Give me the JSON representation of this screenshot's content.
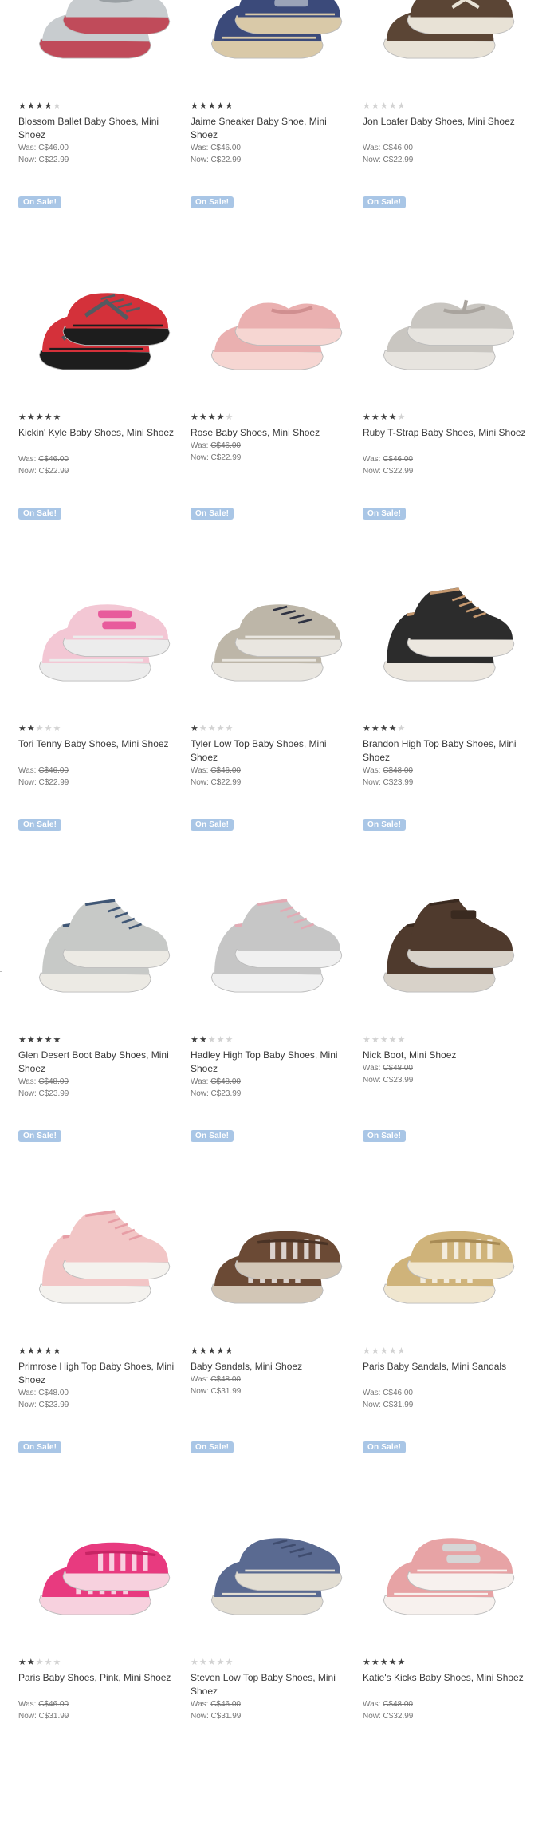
{
  "badge_label": "On Sale!",
  "was_label": "Was:",
  "now_label": "Now:",
  "products": [
    {
      "name": "Blossom Ballet Baby Shoes, Mini Shoez",
      "stars": 4,
      "was": "C$46.00",
      "now": "C$22.99",
      "image": "ballet-flat",
      "colors": [
        "#c8cccf",
        "#9aa0a4",
        "#c04b5a"
      ]
    },
    {
      "name": "Jaime Sneaker Baby Shoe, Mini Shoez",
      "stars": 5,
      "was": "C$46.00",
      "now": "C$22.99",
      "image": "velcro-sneaker",
      "colors": [
        "#3b4a7a",
        "#9aa3b8",
        "#d9c9a8"
      ]
    },
    {
      "name": "Jon Loafer Baby Shoes, Mini Shoez",
      "stars": 0,
      "was": "C$46.00",
      "now": "C$22.99",
      "image": "loafer",
      "colors": [
        "#5b4535",
        "#3f2e22",
        "#e8e2d6"
      ]
    },
    {
      "name": "Kickin' Kyle Baby Shoes, Mini Shoez",
      "stars": 5,
      "was": "C$46.00",
      "now": "C$22.99",
      "image": "sneaker",
      "colors": [
        "#d4313a",
        "#555a60",
        "#1d1d1d"
      ]
    },
    {
      "name": "Rose Baby Shoes, Mini Shoez",
      "stars": 4,
      "was": "C$46.00",
      "now": "C$22.99",
      "image": "ballet-flat",
      "colors": [
        "#eab0b0",
        "#d08f90",
        "#f6d6d2"
      ]
    },
    {
      "name": "Ruby T-Strap Baby Shoes, Mini Shoez",
      "stars": 4,
      "was": "C$46.00",
      "now": "C$22.99",
      "image": "t-strap",
      "colors": [
        "#c9c6c1",
        "#a9a49e",
        "#e7e4df"
      ]
    },
    {
      "name": "Tori Tenny Baby Shoes, Mini Shoez",
      "stars": 2,
      "was": "C$46.00",
      "now": "C$22.99",
      "image": "velcro-sneaker",
      "colors": [
        "#f3c7d4",
        "#e85b9c",
        "#ececec"
      ]
    },
    {
      "name": "Tyler Low Top Baby Shoes, Mini Shoez",
      "stars": 1,
      "was": "C$46.00",
      "now": "C$22.99",
      "image": "low-top",
      "colors": [
        "#bdb6a8",
        "#2f3343",
        "#e9e6e0"
      ]
    },
    {
      "name": "Brandon High Top Baby Shoes, Mini Shoez",
      "stars": 4,
      "was": "C$48.00",
      "now": "C$23.99",
      "image": "high-top",
      "colors": [
        "#2c2c2c",
        "#c79a70",
        "#ece7df"
      ]
    },
    {
      "name": "Glen Desert Boot Baby Shoes, Mini Shoez",
      "stars": 5,
      "was": "C$48.00",
      "now": "C$23.99",
      "image": "desert-boot",
      "colors": [
        "#c7c9c7",
        "#3f5675",
        "#eceae4"
      ]
    },
    {
      "name": "Hadley High Top Baby Shoes, Mini Shoez",
      "stars": 2,
      "was": "C$48.00",
      "now": "C$23.99",
      "image": "high-top",
      "colors": [
        "#c6c6c6",
        "#e3aab4",
        "#f0f0f0"
      ]
    },
    {
      "name": "Nick Boot, Mini Shoez",
      "stars": 0,
      "was": "C$48.00",
      "now": "C$23.99",
      "image": "boot",
      "colors": [
        "#4f3a2d",
        "#3a2a20",
        "#d8d2c9"
      ]
    },
    {
      "name": "Primrose High Top Baby Shoes, Mini Shoez",
      "stars": 5,
      "was": "C$48.00",
      "now": "C$23.99",
      "image": "high-top",
      "colors": [
        "#f2c6c6",
        "#e79ea6",
        "#f4f2ee"
      ]
    },
    {
      "name": "Baby Sandals, Mini Shoez",
      "stars": 5,
      "was": "C$48.00",
      "now": "C$31.99",
      "image": "sandal",
      "colors": [
        "#6b4a35",
        "#4a3325",
        "#d2c6b6"
      ]
    },
    {
      "name": "Paris Baby Sandals, Mini Sandals",
      "stars": 0,
      "was": "C$46.00",
      "now": "C$31.99",
      "image": "sandal",
      "colors": [
        "#cfb37a",
        "#a88b55",
        "#f0e6cf"
      ]
    },
    {
      "name": "Paris Baby Shoes, Pink, Mini Shoez",
      "stars": 2,
      "was": "C$46.00",
      "now": "C$31.99",
      "image": "sandal",
      "colors": [
        "#e83a7f",
        "#c72464",
        "#f7d1de"
      ]
    },
    {
      "name": "Steven Low Top Baby Shoes, Mini Shoez",
      "stars": 0,
      "was": "C$46.00",
      "now": "C$31.99",
      "image": "low-top",
      "colors": [
        "#5a6a91",
        "#3f4c6e",
        "#e2ddd2"
      ]
    },
    {
      "name": "Katie's Kicks Baby Shoes, Mini Shoez",
      "stars": 5,
      "was": "C$48.00",
      "now": "C$32.99",
      "image": "velcro-sneaker",
      "colors": [
        "#e7a3a5",
        "#d6d6d6",
        "#f7f1ee"
      ]
    }
  ]
}
